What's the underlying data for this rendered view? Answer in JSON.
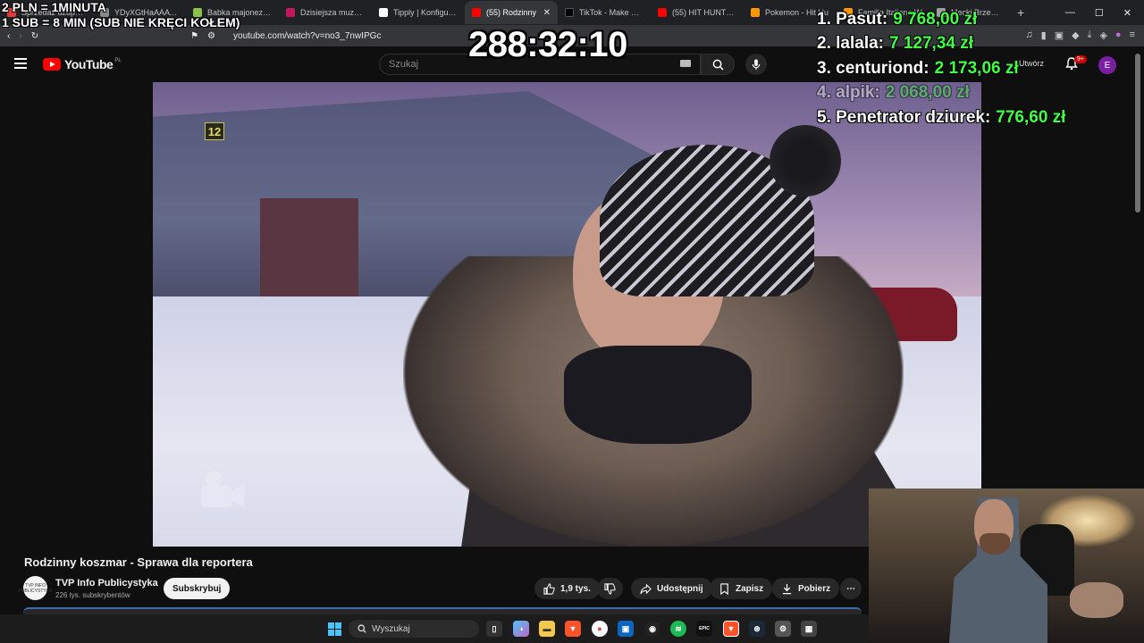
{
  "overlay": {
    "rule_line1": "2 PLN = 1MINUTA",
    "rule_line2": "1 SUB = 8 MIN (SUB NIE KRĘCI KOŁEM)",
    "timer": "288:32:10",
    "leaderboard": [
      {
        "name": "1. Pasut:",
        "amount": "9 768,00 zł"
      },
      {
        "name": "2. lalala:",
        "amount": "7 127,34 zł"
      },
      {
        "name": "3. centuriond:",
        "amount": "2 173,06 zł"
      },
      {
        "name": "4. alpik:",
        "amount": "2 068,00 zł"
      },
      {
        "name": "5. Penetrator dziurek:",
        "amount": "776,60 zł"
      }
    ]
  },
  "browser": {
    "tabs": [
      {
        "title": "Sprzedaż uzupełnij",
        "color": "#e53935"
      },
      {
        "title": "YDyXGtHaAAATDVG",
        "color": "#888888"
      },
      {
        "title": "Babka majonezowa",
        "color": "#8bc34a"
      },
      {
        "title": "Dzisiejsza muzyczna",
        "color": "#c2185b"
      },
      {
        "title": "Tipply | Konfiguratu",
        "color": "#ffffff"
      },
      {
        "title": "(55) Rodzinny",
        "color": "#ff0000"
      },
      {
        "title": "TikTok - Make Your",
        "color": "#000000"
      },
      {
        "title": "(55) HIT HUNTERS",
        "color": "#ff0000"
      },
      {
        "title": "Pokemon - Hit Hu",
        "color": "#ff9800"
      },
      {
        "title": "Familia Italiana W",
        "color": "#ff9800"
      },
      {
        "title": "Mecki Brzezami",
        "color": "#9e9e9e"
      }
    ],
    "url": "youtube.com/watch?v=no3_7nwIPGc"
  },
  "youtube": {
    "logo_text": "YouTube",
    "country": "PL",
    "search_placeholder": "Szukaj",
    "create_label": "Utwórz",
    "notifications_badge": "9+",
    "avatar_letter": "E"
  },
  "video": {
    "channel_badge": "12",
    "title": "Rodzinny koszmar - Sprawa dla reportera",
    "channel": "TVP Info Publicystyka",
    "channel_avatar_text": "TVP INFO PUBLICYSTYKA",
    "subscribers": "226 tys. subskrybentów",
    "subscribe_label": "Subskrybuj",
    "likes": "1,9 tys.",
    "share_label": "Udostępnij",
    "save_label": "Zapisz",
    "download_label": "Pobierz"
  },
  "taskbar": {
    "search_placeholder": "Wyszukaj"
  }
}
